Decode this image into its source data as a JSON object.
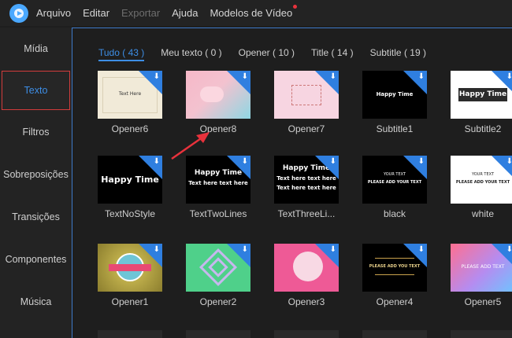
{
  "menu": {
    "items": [
      {
        "label": "Arquivo",
        "disabled": false
      },
      {
        "label": "Editar",
        "disabled": false
      },
      {
        "label": "Exportar",
        "disabled": true
      },
      {
        "label": "Ajuda",
        "disabled": false
      },
      {
        "label": "Modelos de Vídeo",
        "disabled": false,
        "badge_dot": true
      }
    ]
  },
  "sidebar": {
    "items": [
      {
        "label": "Mídia"
      },
      {
        "label": "Texto",
        "active": true
      },
      {
        "label": "Filtros"
      },
      {
        "label": "Sobreposições"
      },
      {
        "label": "Transições"
      },
      {
        "label": "Componentes"
      },
      {
        "label": "Música"
      }
    ]
  },
  "tabs": [
    {
      "label": "Tudo ( 43 )",
      "active": true
    },
    {
      "label": "Meu texto ( 0 )"
    },
    {
      "label": "Opener ( 10 )"
    },
    {
      "label": "Title ( 14 )"
    },
    {
      "label": "Subtitle ( 19 )"
    }
  ],
  "thumb_texts": {
    "happy_time": "Happy Time",
    "text_here": "Text here text here",
    "your_text": "YOUR TEXT",
    "please_add": "PLEASE ADD YOUR TEXT"
  },
  "templates": [
    {
      "name": "Opener6"
    },
    {
      "name": "Opener8"
    },
    {
      "name": "Opener7"
    },
    {
      "name": "Subtitle1"
    },
    {
      "name": "Subtitle2"
    },
    {
      "name": "TextNoStyle"
    },
    {
      "name": "TextTwoLines"
    },
    {
      "name": "TextThreeLi..."
    },
    {
      "name": "black"
    },
    {
      "name": "white"
    },
    {
      "name": "Opener1"
    },
    {
      "name": "Opener2"
    },
    {
      "name": "Opener3"
    },
    {
      "name": "Opener4"
    },
    {
      "name": "Opener5"
    }
  ],
  "colors": {
    "accent": "#3d8ee6",
    "download_badge": "#2f7fe0",
    "active_border": "#d33c3c",
    "annotation_arrow": "#e8323c"
  }
}
